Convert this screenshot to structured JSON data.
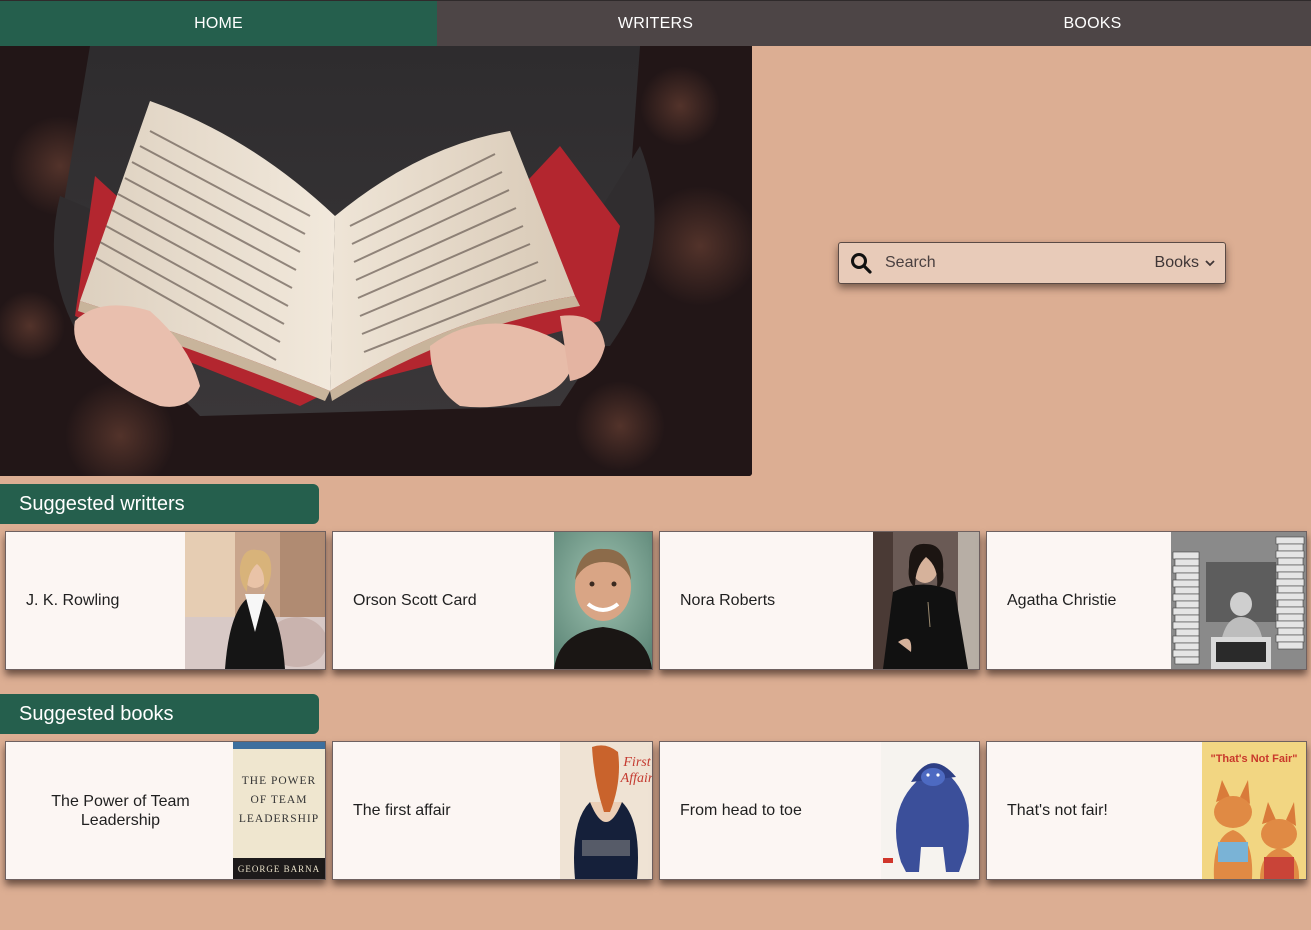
{
  "nav": {
    "items": [
      {
        "label": "HOME",
        "active": true
      },
      {
        "label": "WRITERS",
        "active": false
      },
      {
        "label": "BOOKS",
        "active": false
      }
    ]
  },
  "search": {
    "placeholder": "Search",
    "value": "",
    "category": "Books",
    "icon": "search-icon"
  },
  "writers": {
    "title": "Suggested writters",
    "items": [
      {
        "name": "J. K. Rowling"
      },
      {
        "name": "Orson Scott Card"
      },
      {
        "name": "Nora Roberts"
      },
      {
        "name": "Agatha Christie"
      }
    ]
  },
  "books": {
    "title": "Suggested books",
    "items": [
      {
        "title": "The Power of Team Leadership",
        "cover_lines": [
          "THE POWER",
          "OF TEAM",
          "LEADERSHIP"
        ],
        "cover_author": "GEORGE BARNA"
      },
      {
        "title": "The first affair",
        "cover_lines": [
          "First",
          "Affair"
        ]
      },
      {
        "title": "From head to toe"
      },
      {
        "title": "That's not fair!",
        "cover_lines": [
          "\"That's Not Fair\""
        ]
      }
    ]
  },
  "colors": {
    "background": "#dcae93",
    "nav": "#4d4546",
    "accent": "#255f4d",
    "card": "#fcf6f3"
  }
}
